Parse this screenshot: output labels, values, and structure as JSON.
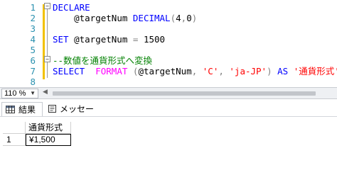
{
  "editor": {
    "lines": [
      {
        "num": "1",
        "tokens": [
          {
            "t": "DECLARE",
            "c": "kw"
          }
        ]
      },
      {
        "num": "2",
        "tokens": [
          {
            "t": "    ",
            "c": "var"
          },
          {
            "t": "@targetNum",
            "c": "var"
          },
          {
            "t": " ",
            "c": "var"
          },
          {
            "t": "DECIMAL",
            "c": "kw"
          },
          {
            "t": "(",
            "c": "op"
          },
          {
            "t": "4",
            "c": "var"
          },
          {
            "t": ",",
            "c": "op"
          },
          {
            "t": "0",
            "c": "var"
          },
          {
            "t": ")",
            "c": "op"
          }
        ]
      },
      {
        "num": "3",
        "tokens": []
      },
      {
        "num": "4",
        "tokens": [
          {
            "t": "SET",
            "c": "kw"
          },
          {
            "t": " @targetNum ",
            "c": "var"
          },
          {
            "t": "=",
            "c": "op"
          },
          {
            "t": " 1500",
            "c": "var"
          }
        ]
      },
      {
        "num": "5",
        "tokens": []
      },
      {
        "num": "6",
        "tokens": [
          {
            "t": "--数値を通貨形式へ変換",
            "c": "cmt"
          }
        ]
      },
      {
        "num": "7",
        "tokens": [
          {
            "t": "SELECT",
            "c": "kw"
          },
          {
            "t": "  ",
            "c": "var"
          },
          {
            "t": "FORMAT",
            "c": "fn"
          },
          {
            "t": " ",
            "c": "var"
          },
          {
            "t": "(",
            "c": "op"
          },
          {
            "t": "@targetNum",
            "c": "var"
          },
          {
            "t": ", ",
            "c": "op"
          },
          {
            "t": "'C'",
            "c": "str"
          },
          {
            "t": ", ",
            "c": "op"
          },
          {
            "t": "'ja-JP'",
            "c": "str"
          },
          {
            "t": ")",
            "c": "op"
          },
          {
            "t": " ",
            "c": "var"
          },
          {
            "t": "AS",
            "c": "kw"
          },
          {
            "t": " ",
            "c": "var"
          },
          {
            "t": "'通貨形式'",
            "c": "str"
          }
        ]
      },
      {
        "num": "8",
        "tokens": []
      }
    ]
  },
  "zoom": {
    "value": "110 %"
  },
  "tabs": {
    "results": "結果",
    "messages": "メッセージ"
  },
  "grid": {
    "header": "通貨形式",
    "row_number": "1",
    "cell": "¥1,500"
  },
  "colors": {
    "keyword": "#0000ff",
    "function": "#ff00ff",
    "string": "#ff0000",
    "comment": "#008000",
    "line_number": "#2b91af",
    "fold_bar": "#f2c200"
  }
}
